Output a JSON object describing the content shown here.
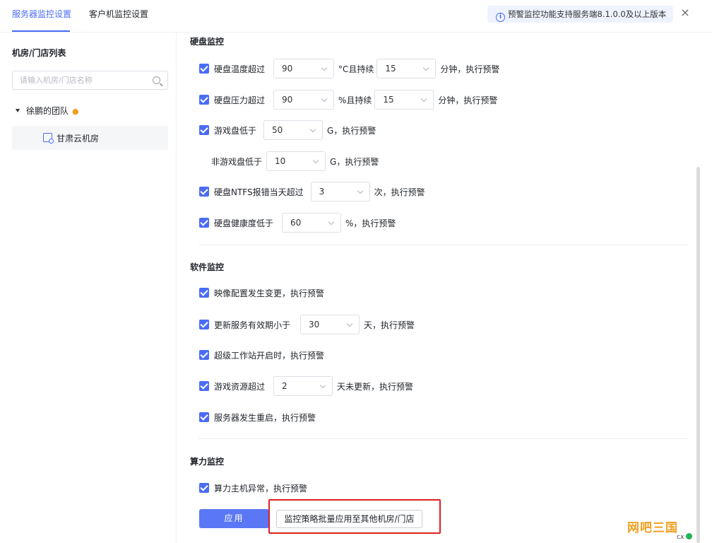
{
  "tabs": [
    {
      "label": "服务器监控设置",
      "active": true
    },
    {
      "label": "客户机监控设置",
      "active": false
    }
  ],
  "notice": {
    "text": "预警监控功能支持服务端8.1.0.0及以上版本",
    "icon": "info-icon"
  },
  "close_label": "×",
  "sidebar": {
    "title": "机房/门店列表",
    "search_placeholder": "请输入机房/门店名称",
    "tree_root": "徐鹏的团队",
    "tree_child": "甘肃云机房"
  },
  "sections": {
    "disk": "硬盘监控",
    "software": "软件监控",
    "compute": "算力监控"
  },
  "disk": {
    "temp": {
      "label": "硬盘温度超过",
      "v1": "90",
      "mid": "°C且持续",
      "v2": "15",
      "tail": "分钟，执行预警"
    },
    "pressure": {
      "label": "硬盘压力超过",
      "v1": "90",
      "mid": "%且持续",
      "v2": "15",
      "tail": "分钟，执行预警"
    },
    "game": {
      "label": "游戏盘低于",
      "v": "50",
      "tail": "G，执行预警"
    },
    "nongame": {
      "label": "非游戏盘低于",
      "v": "10",
      "tail": "G，执行预警"
    },
    "ntfs": {
      "label": "硬盘NTFS报错当天超过",
      "v": "3",
      "tail": "次，执行预警"
    },
    "health": {
      "label": "硬盘健康度低于",
      "v": "60",
      "tail": "%，执行预警"
    }
  },
  "software": {
    "image": "映像配置发生变更，执行预警",
    "update": {
      "label": "更新服务有效期小于",
      "v": "30",
      "tail": "天，执行预警"
    },
    "super": "超级工作站开启时，执行预警",
    "resource": {
      "label": "游戏资源超过",
      "v": "2",
      "tail": "天未更新，执行预警"
    },
    "reboot": "服务器发生重启，执行预警"
  },
  "compute": {
    "host": "算力主机异常，执行预警"
  },
  "buttons": {
    "apply": "应用",
    "batch": "监控策略批量应用至其他机房/门店"
  },
  "watermark": "网吧三国",
  "corner_text": "cx"
}
